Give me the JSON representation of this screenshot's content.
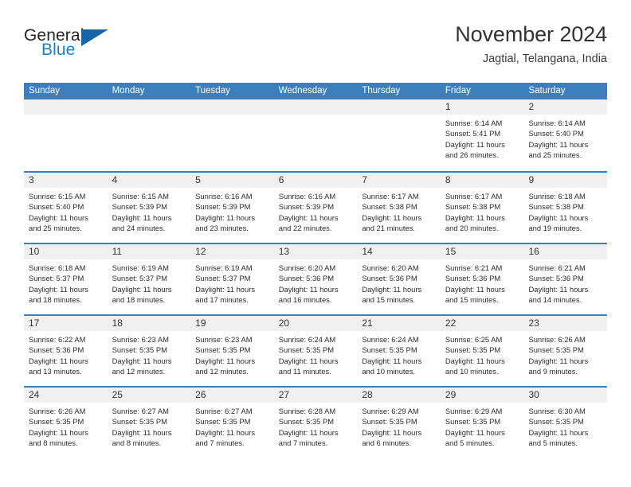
{
  "brand": {
    "word_one": "General",
    "word_two": "Blue",
    "flag_icon": "triangle-flag-icon",
    "accent_color": "#1f7fc4",
    "flag_color": "#1565a8"
  },
  "header": {
    "title": "November 2024",
    "subtitle": "Jagtial, Telangana, India"
  },
  "calendar": {
    "header_bg": "#3b7fbf",
    "row_border_color": "#3b7fbf",
    "day_head_bg": "#f0f0f0",
    "weekdays": [
      "Sunday",
      "Monday",
      "Tuesday",
      "Wednesday",
      "Thursday",
      "Friday",
      "Saturday"
    ],
    "weeks": [
      [
        {
          "day": "",
          "empty": true
        },
        {
          "day": "",
          "empty": true
        },
        {
          "day": "",
          "empty": true
        },
        {
          "day": "",
          "empty": true
        },
        {
          "day": "",
          "empty": true
        },
        {
          "day": "1",
          "sunrise": "Sunrise: 6:14 AM",
          "sunset": "Sunset: 5:41 PM",
          "daylight_1": "Daylight: 11 hours",
          "daylight_2": "and 26 minutes."
        },
        {
          "day": "2",
          "sunrise": "Sunrise: 6:14 AM",
          "sunset": "Sunset: 5:40 PM",
          "daylight_1": "Daylight: 11 hours",
          "daylight_2": "and 25 minutes."
        }
      ],
      [
        {
          "day": "3",
          "sunrise": "Sunrise: 6:15 AM",
          "sunset": "Sunset: 5:40 PM",
          "daylight_1": "Daylight: 11 hours",
          "daylight_2": "and 25 minutes."
        },
        {
          "day": "4",
          "sunrise": "Sunrise: 6:15 AM",
          "sunset": "Sunset: 5:39 PM",
          "daylight_1": "Daylight: 11 hours",
          "daylight_2": "and 24 minutes."
        },
        {
          "day": "5",
          "sunrise": "Sunrise: 6:16 AM",
          "sunset": "Sunset: 5:39 PM",
          "daylight_1": "Daylight: 11 hours",
          "daylight_2": "and 23 minutes."
        },
        {
          "day": "6",
          "sunrise": "Sunrise: 6:16 AM",
          "sunset": "Sunset: 5:39 PM",
          "daylight_1": "Daylight: 11 hours",
          "daylight_2": "and 22 minutes."
        },
        {
          "day": "7",
          "sunrise": "Sunrise: 6:17 AM",
          "sunset": "Sunset: 5:38 PM",
          "daylight_1": "Daylight: 11 hours",
          "daylight_2": "and 21 minutes."
        },
        {
          "day": "8",
          "sunrise": "Sunrise: 6:17 AM",
          "sunset": "Sunset: 5:38 PM",
          "daylight_1": "Daylight: 11 hours",
          "daylight_2": "and 20 minutes."
        },
        {
          "day": "9",
          "sunrise": "Sunrise: 6:18 AM",
          "sunset": "Sunset: 5:38 PM",
          "daylight_1": "Daylight: 11 hours",
          "daylight_2": "and 19 minutes."
        }
      ],
      [
        {
          "day": "10",
          "sunrise": "Sunrise: 6:18 AM",
          "sunset": "Sunset: 5:37 PM",
          "daylight_1": "Daylight: 11 hours",
          "daylight_2": "and 18 minutes."
        },
        {
          "day": "11",
          "sunrise": "Sunrise: 6:19 AM",
          "sunset": "Sunset: 5:37 PM",
          "daylight_1": "Daylight: 11 hours",
          "daylight_2": "and 18 minutes."
        },
        {
          "day": "12",
          "sunrise": "Sunrise: 6:19 AM",
          "sunset": "Sunset: 5:37 PM",
          "daylight_1": "Daylight: 11 hours",
          "daylight_2": "and 17 minutes."
        },
        {
          "day": "13",
          "sunrise": "Sunrise: 6:20 AM",
          "sunset": "Sunset: 5:36 PM",
          "daylight_1": "Daylight: 11 hours",
          "daylight_2": "and 16 minutes."
        },
        {
          "day": "14",
          "sunrise": "Sunrise: 6:20 AM",
          "sunset": "Sunset: 5:36 PM",
          "daylight_1": "Daylight: 11 hours",
          "daylight_2": "and 15 minutes."
        },
        {
          "day": "15",
          "sunrise": "Sunrise: 6:21 AM",
          "sunset": "Sunset: 5:36 PM",
          "daylight_1": "Daylight: 11 hours",
          "daylight_2": "and 15 minutes."
        },
        {
          "day": "16",
          "sunrise": "Sunrise: 6:21 AM",
          "sunset": "Sunset: 5:36 PM",
          "daylight_1": "Daylight: 11 hours",
          "daylight_2": "and 14 minutes."
        }
      ],
      [
        {
          "day": "17",
          "sunrise": "Sunrise: 6:22 AM",
          "sunset": "Sunset: 5:36 PM",
          "daylight_1": "Daylight: 11 hours",
          "daylight_2": "and 13 minutes."
        },
        {
          "day": "18",
          "sunrise": "Sunrise: 6:23 AM",
          "sunset": "Sunset: 5:35 PM",
          "daylight_1": "Daylight: 11 hours",
          "daylight_2": "and 12 minutes."
        },
        {
          "day": "19",
          "sunrise": "Sunrise: 6:23 AM",
          "sunset": "Sunset: 5:35 PM",
          "daylight_1": "Daylight: 11 hours",
          "daylight_2": "and 12 minutes."
        },
        {
          "day": "20",
          "sunrise": "Sunrise: 6:24 AM",
          "sunset": "Sunset: 5:35 PM",
          "daylight_1": "Daylight: 11 hours",
          "daylight_2": "and 11 minutes."
        },
        {
          "day": "21",
          "sunrise": "Sunrise: 6:24 AM",
          "sunset": "Sunset: 5:35 PM",
          "daylight_1": "Daylight: 11 hours",
          "daylight_2": "and 10 minutes."
        },
        {
          "day": "22",
          "sunrise": "Sunrise: 6:25 AM",
          "sunset": "Sunset: 5:35 PM",
          "daylight_1": "Daylight: 11 hours",
          "daylight_2": "and 10 minutes."
        },
        {
          "day": "23",
          "sunrise": "Sunrise: 6:26 AM",
          "sunset": "Sunset: 5:35 PM",
          "daylight_1": "Daylight: 11 hours",
          "daylight_2": "and 9 minutes."
        }
      ],
      [
        {
          "day": "24",
          "sunrise": "Sunrise: 6:26 AM",
          "sunset": "Sunset: 5:35 PM",
          "daylight_1": "Daylight: 11 hours",
          "daylight_2": "and 8 minutes."
        },
        {
          "day": "25",
          "sunrise": "Sunrise: 6:27 AM",
          "sunset": "Sunset: 5:35 PM",
          "daylight_1": "Daylight: 11 hours",
          "daylight_2": "and 8 minutes."
        },
        {
          "day": "26",
          "sunrise": "Sunrise: 6:27 AM",
          "sunset": "Sunset: 5:35 PM",
          "daylight_1": "Daylight: 11 hours",
          "daylight_2": "and 7 minutes."
        },
        {
          "day": "27",
          "sunrise": "Sunrise: 6:28 AM",
          "sunset": "Sunset: 5:35 PM",
          "daylight_1": "Daylight: 11 hours",
          "daylight_2": "and 7 minutes."
        },
        {
          "day": "28",
          "sunrise": "Sunrise: 6:29 AM",
          "sunset": "Sunset: 5:35 PM",
          "daylight_1": "Daylight: 11 hours",
          "daylight_2": "and 6 minutes."
        },
        {
          "day": "29",
          "sunrise": "Sunrise: 6:29 AM",
          "sunset": "Sunset: 5:35 PM",
          "daylight_1": "Daylight: 11 hours",
          "daylight_2": "and 5 minutes."
        },
        {
          "day": "30",
          "sunrise": "Sunrise: 6:30 AM",
          "sunset": "Sunset: 5:35 PM",
          "daylight_1": "Daylight: 11 hours",
          "daylight_2": "and 5 minutes."
        }
      ]
    ]
  }
}
